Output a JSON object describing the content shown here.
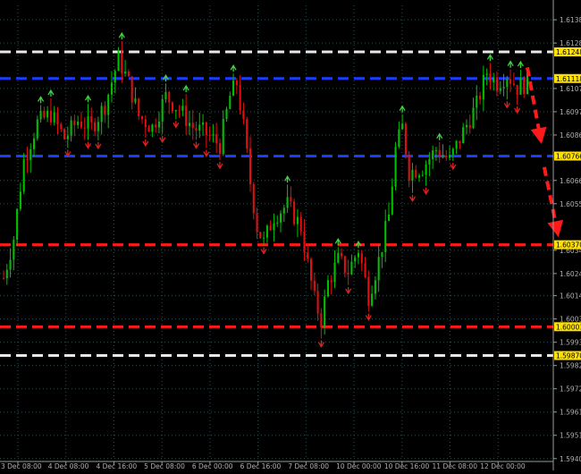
{
  "chart_data": {
    "type": "candlestick",
    "ylim": [
      1.594,
      1.6145
    ],
    "grid": true,
    "colors": {
      "background": "#000000",
      "grid": "#2f4f4f",
      "bull": "#00c000",
      "bear": "#e01010",
      "up_arrow": "#40d040",
      "down_arrow": "#e02020",
      "white_level": "#e8e8e8",
      "blue_level": "#1a3cff",
      "red_level": "#ff1a1a",
      "level_label_bg": "#ffe000",
      "axis_text": "#b0b0b0"
    },
    "y_ticks": [
      "1.61385",
      "1.61280",
      "1.61075",
      "1.60970",
      "1.60865",
      "1.60660",
      "1.60555",
      "1.60345",
      "1.60240",
      "1.60140",
      "1.60035",
      "1.59930",
      "1.59825",
      "1.59720",
      "1.59615",
      "1.59510",
      "1.59405"
    ],
    "x_ticks": [
      "3 Dec 08:00",
      "4 Dec 08:00",
      "4 Dec 16:00",
      "5 Dec 08:00",
      "6 Dec 00:00",
      "6 Dec 16:00",
      "7 Dec 08:00",
      "10 Dec 00:00",
      "10 Dec 16:00",
      "11 Dec 08:00",
      "12 Dec 00:00"
    ],
    "levels": [
      {
        "value": 1.6124,
        "label": "1.61248",
        "style": "white"
      },
      {
        "value": 1.6112,
        "label": "1.61118",
        "style": "blue"
      },
      {
        "value": 1.6077,
        "label": "1.60766",
        "style": "blue"
      },
      {
        "value": 1.6037,
        "label": "1.60370",
        "style": "red"
      },
      {
        "value": 1.6,
        "label": "1.60003",
        "style": "red"
      },
      {
        "value": 1.5987,
        "label": "1.59870",
        "style": "white"
      }
    ],
    "price_anchors": [
      [
        0,
        1.6022
      ],
      [
        3,
        1.604
      ],
      [
        6,
        1.6075
      ],
      [
        10,
        1.6092
      ],
      [
        14,
        1.6096
      ],
      [
        18,
        1.6085
      ],
      [
        22,
        1.6093
      ],
      [
        26,
        1.609
      ],
      [
        30,
        1.61
      ],
      [
        34,
        1.6121
      ],
      [
        37,
        1.611
      ],
      [
        40,
        1.6095
      ],
      [
        44,
        1.609
      ],
      [
        48,
        1.6104
      ],
      [
        52,
        1.6098
      ],
      [
        56,
        1.609
      ],
      [
        60,
        1.6087
      ],
      [
        64,
        1.6082
      ],
      [
        67,
        1.6104
      ],
      [
        69,
        1.611
      ],
      [
        71,
        1.609
      ],
      [
        73,
        1.6065
      ],
      [
        75,
        1.6045
      ],
      [
        77,
        1.6038
      ],
      [
        80,
        1.605
      ],
      [
        84,
        1.6055
      ],
      [
        88,
        1.6045
      ],
      [
        90,
        1.6028
      ],
      [
        92,
        1.6012
      ],
      [
        94,
        1.6003
      ],
      [
        96,
        1.602
      ],
      [
        99,
        1.603
      ],
      [
        102,
        1.6025
      ],
      [
        105,
        1.6035
      ],
      [
        108,
        1.6014
      ],
      [
        111,
        1.603
      ],
      [
        114,
        1.605
      ],
      [
        116,
        1.608
      ],
      [
        118,
        1.609
      ],
      [
        120,
        1.607
      ],
      [
        124,
        1.6072
      ],
      [
        128,
        1.608
      ],
      [
        132,
        1.6075
      ],
      [
        136,
        1.6088
      ],
      [
        140,
        1.61
      ],
      [
        143,
        1.6115
      ],
      [
        146,
        1.611
      ],
      [
        149,
        1.6114
      ],
      [
        152,
        1.6108
      ],
      [
        155,
        1.611
      ]
    ],
    "projection": [
      {
        "from": [
          155,
          1.6117
        ],
        "to": [
          159,
          1.6084
        ]
      },
      {
        "from": [
          160,
          1.6072
        ],
        "to": [
          164,
          1.6042
        ]
      }
    ]
  }
}
